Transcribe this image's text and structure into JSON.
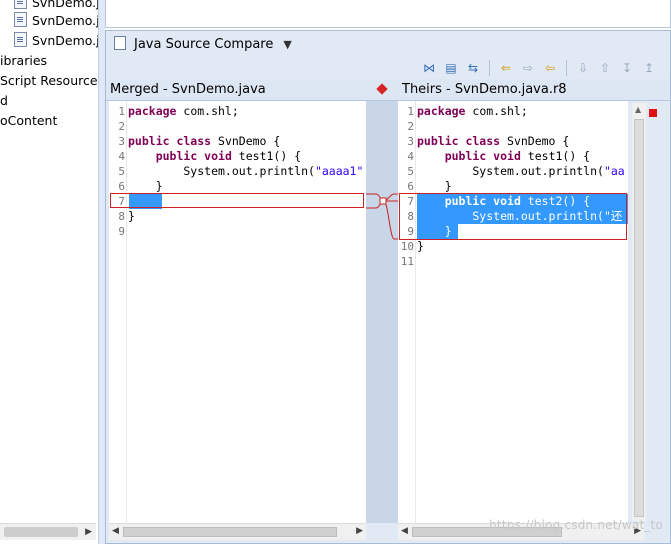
{
  "tree": {
    "items": [
      {
        "label": "SvnDemo.j",
        "icon": "java-file-icon"
      },
      {
        "label": "SvnDemo.j",
        "icon": "java-file-icon"
      },
      {
        "label": "SvnDemo.j",
        "icon": "java-file-icon"
      },
      {
        "label": "ibraries",
        "icon": ""
      },
      {
        "label": "Script Resources",
        "icon": ""
      },
      {
        "label": "d",
        "icon": ""
      },
      {
        "label": "oContent",
        "icon": ""
      }
    ]
  },
  "compare": {
    "title": "Java Source Compare",
    "toolbar_icons": [
      "ignore-whitespace-icon",
      "show-ancestor-icon",
      "swap-sides-icon",
      "copy-all-left-icon",
      "copy-current-right-icon",
      "copy-current-left-icon",
      "next-difference-icon",
      "previous-difference-icon",
      "next-change-icon",
      "previous-change-icon"
    ],
    "left": {
      "header": "Merged - SvnDemo.java",
      "lines": [
        {
          "n": "1",
          "text": "package com.shl;"
        },
        {
          "n": "2",
          "text": ""
        },
        {
          "n": "3",
          "text": "public class SvnDemo {"
        },
        {
          "n": "4",
          "text": "    public void test1() {"
        },
        {
          "n": "5",
          "text": "        System.out.println(\"aaaa1\""
        },
        {
          "n": "6",
          "text": "    }"
        },
        {
          "n": "7",
          "text": ""
        },
        {
          "n": "8",
          "text": "}"
        },
        {
          "n": "9",
          "text": ""
        }
      ]
    },
    "right": {
      "header": "Theirs - SvnDemo.java.r8",
      "lines": [
        {
          "n": "1",
          "text": "package com.shl;"
        },
        {
          "n": "2",
          "text": ""
        },
        {
          "n": "3",
          "text": "public class SvnDemo {"
        },
        {
          "n": "4",
          "text": "    public void test1() {"
        },
        {
          "n": "5",
          "text": "        System.out.println(\"aa"
        },
        {
          "n": "6",
          "text": "    }"
        },
        {
          "n": "7",
          "text": "    public void test2() {"
        },
        {
          "n": "8",
          "text": "        System.out.println(\"还"
        },
        {
          "n": "9",
          "text": "    }"
        },
        {
          "n": "10",
          "text": "}"
        },
        {
          "n": "11",
          "text": ""
        }
      ]
    }
  },
  "watermark": "https://blog.csdn.net/wat_to",
  "colors": {
    "selection": "#3399ff",
    "diff_border": "#cc2222",
    "keyword": "#7f0055",
    "string": "#2a00ff"
  }
}
